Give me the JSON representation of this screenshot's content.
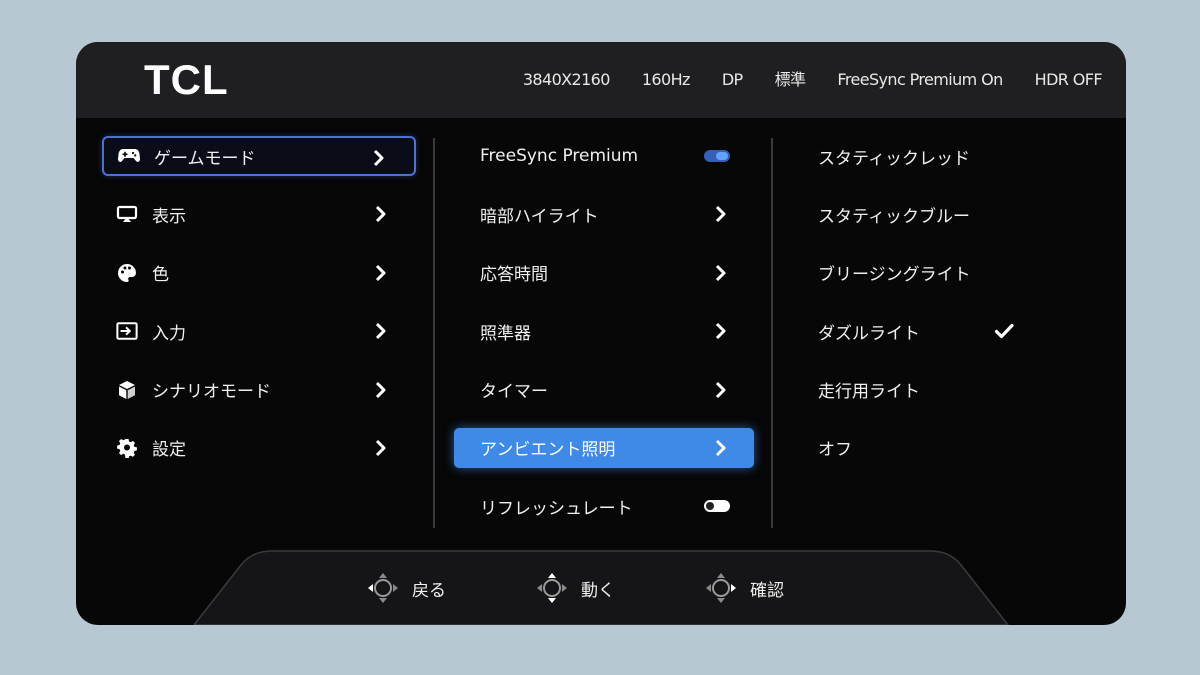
{
  "brand": {
    "logo": "TCL"
  },
  "status_bar": {
    "resolution": "3840X2160",
    "refresh": "160Hz",
    "input": "DP",
    "mode": "標準",
    "freesync": "FreeSync Premium On",
    "hdr": "HDR OFF"
  },
  "main_menu": {
    "items": [
      {
        "label": "ゲームモード",
        "icon": "gamepad-icon",
        "state": "focused"
      },
      {
        "label": "表示",
        "icon": "display-icon",
        "state": "normal"
      },
      {
        "label": "色",
        "icon": "palette-icon",
        "state": "normal"
      },
      {
        "label": "入力",
        "icon": "input-icon",
        "state": "normal"
      },
      {
        "label": "シナリオモード",
        "icon": "cube-icon",
        "state": "normal"
      },
      {
        "label": "設定",
        "icon": "gear-icon",
        "state": "normal"
      }
    ]
  },
  "sub_menu": {
    "items": [
      {
        "label": "FreeSync Premium",
        "control": "toggle",
        "value": "on"
      },
      {
        "label": "暗部ハイライト",
        "control": "chevron"
      },
      {
        "label": "応答時間",
        "control": "chevron"
      },
      {
        "label": "照準器",
        "control": "chevron"
      },
      {
        "label": "タイマー",
        "control": "chevron"
      },
      {
        "label": "アンビエント照明",
        "control": "chevron",
        "state": "selected"
      },
      {
        "label": "リフレッシュレート",
        "control": "toggle",
        "value": "off"
      }
    ]
  },
  "options_menu": {
    "items": [
      {
        "label": "スタティックレッド",
        "checked": false
      },
      {
        "label": "スタティックブルー",
        "checked": false
      },
      {
        "label": "ブリージングライト",
        "checked": false
      },
      {
        "label": "ダズルライト",
        "checked": true
      },
      {
        "label": "走行用ライト",
        "checked": false
      },
      {
        "label": "オフ",
        "checked": false
      }
    ]
  },
  "bottom_hints": {
    "back": "戻る",
    "move": "動く",
    "confirm": "確認"
  },
  "colors": {
    "osd_background": "#070708",
    "top_bar": "#1f1f21",
    "focus_outline": "#4a72d6",
    "selected_fill": "#3f8ae6",
    "toggle_on": "#3460b8"
  }
}
